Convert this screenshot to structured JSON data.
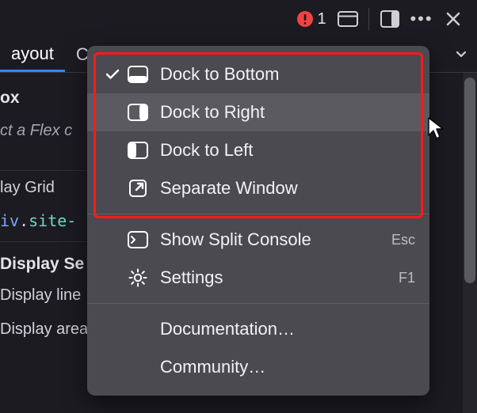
{
  "toolbar": {
    "error_count": "1"
  },
  "tabs": {
    "active_label": "ayout",
    "second_partial": "C"
  },
  "panel": {
    "section_box": "ox",
    "flex_hint": "ct a Flex c",
    "grid_label": "lay Grid",
    "code_tag": "iv",
    "code_class": "site-",
    "display_settings": "Display Se",
    "display_line": "Display line",
    "display_area": "Display area"
  },
  "menu": {
    "dock_bottom": "Dock to Bottom",
    "dock_right": "Dock to Right",
    "dock_left": "Dock to Left",
    "separate_window": "Separate Window",
    "show_split_console": "Show Split Console",
    "show_split_console_accel": "Esc",
    "settings": "Settings",
    "settings_accel": "F1",
    "documentation": "Documentation…",
    "community": "Community…"
  }
}
